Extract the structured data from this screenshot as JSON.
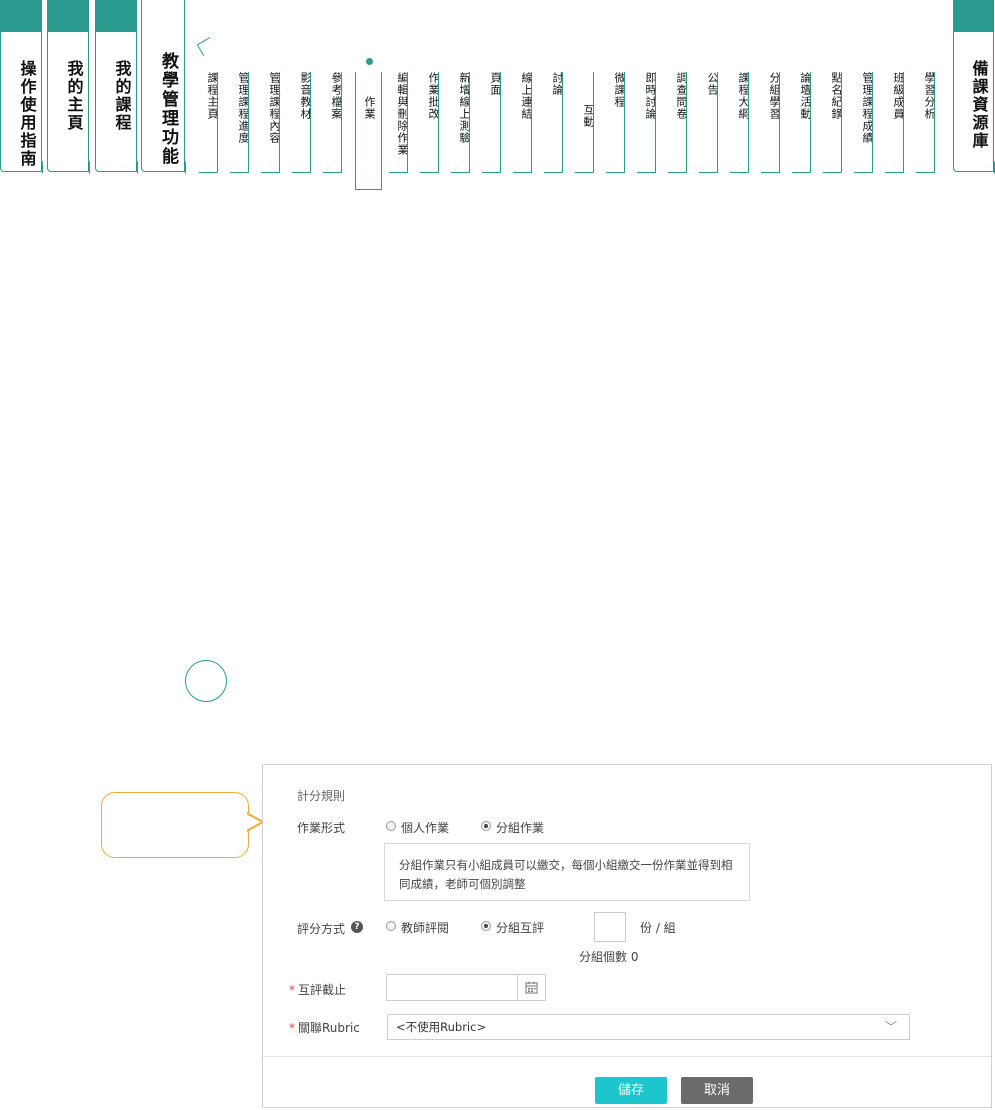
{
  "nav": {
    "main_tabs": [
      {
        "label": "操作使用指南"
      },
      {
        "label": "我的主頁"
      },
      {
        "label": "我的課程"
      },
      {
        "label": "教學管理功能"
      },
      {
        "label": "備課資源庫"
      }
    ],
    "sub_items": [
      "課程主頁",
      "管理課程進度",
      "管理課程內容",
      "影音教材",
      "參考檔案",
      "作業",
      "編輯與刪除作業",
      "作業批改",
      "新增線上測驗",
      "頁面",
      "線上連結",
      "討論",
      "互動",
      "微課程",
      "即時討論",
      "調查問卷",
      "公告",
      "課程大綱",
      "分組學習",
      "論壇活動",
      "點名紀錄",
      "管理課程成績",
      "班級成員",
      "學習分析"
    ],
    "active_sub": "作業"
  },
  "form": {
    "section_title": "計分規則",
    "type_label": "作業形式",
    "type_options": [
      "個人作業",
      "分組作業"
    ],
    "type_selected": "分組作業",
    "tip_text": "分組作業只有小組成員可以繳交，每個小組繳交一份作業並得到相同成績，老師可個別調整",
    "grading_label": "評分方式",
    "grading_options": [
      "教師評閱",
      "分組互評"
    ],
    "grading_selected": "分組互評",
    "per_group_unit": "份 / 組",
    "group_count_text": "分組個數 0",
    "peer_deadline_label": "互評截止",
    "rubric_label": "關聯Rubric",
    "rubric_value": "<不使用Rubric>",
    "required_mark": "*"
  },
  "buttons": {
    "save": "儲存",
    "cancel": "取消"
  },
  "colors": {
    "accent": "#2a9a8e",
    "callout": "#f0a93a",
    "save_button": "#1cc6cc",
    "cancel_button": "#6b6b6b"
  }
}
